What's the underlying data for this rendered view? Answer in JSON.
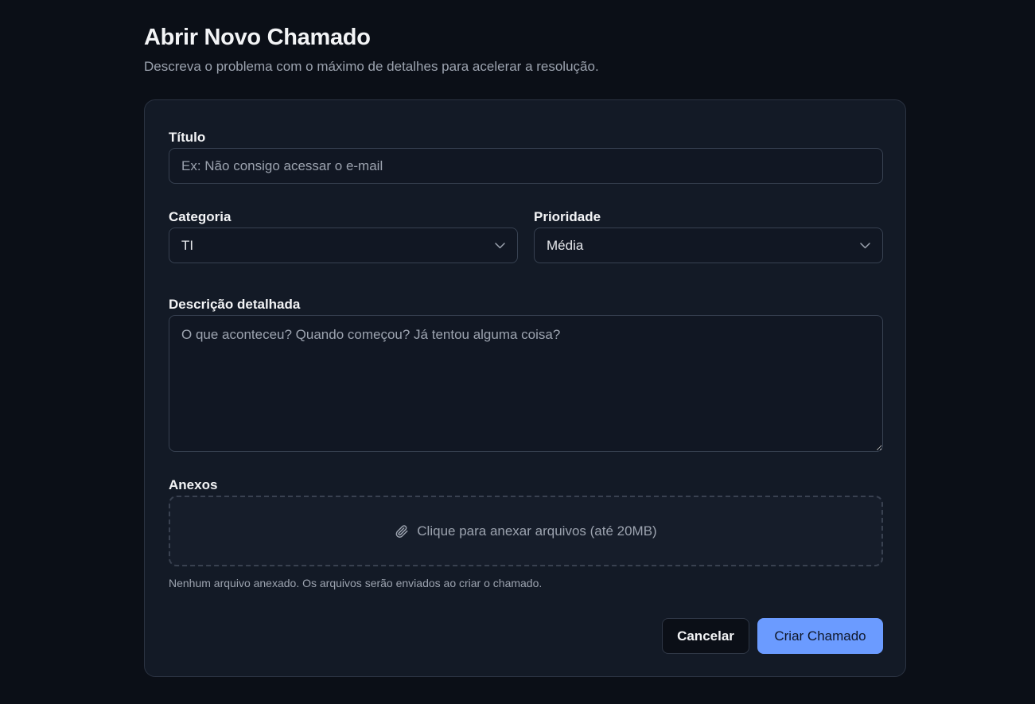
{
  "header": {
    "title": "Abrir Novo Chamado",
    "subtitle": "Descreva o problema com o máximo de detalhes para acelerar a resolução."
  },
  "form": {
    "title_field": {
      "label": "Título",
      "placeholder": "Ex: Não consigo acessar o e-mail",
      "value": ""
    },
    "category": {
      "label": "Categoria",
      "selected": "TI",
      "icon": "chevron-down-icon"
    },
    "priority": {
      "label": "Prioridade",
      "selected": "Média",
      "icon": "chevron-down-icon"
    },
    "description": {
      "label": "Descrição detalhada",
      "placeholder": "O que aconteceu? Quando começou? Já tentou alguma coisa?",
      "value": ""
    },
    "attachments": {
      "label": "Anexos",
      "dropzone_text": "Clique para anexar arquivos (até 20MB)",
      "icon": "paperclip-icon",
      "hint": "Nenhum arquivo anexado. Os arquivos serão enviados ao criar o chamado."
    },
    "actions": {
      "cancel_label": "Cancelar",
      "submit_label": "Criar Chamado"
    }
  },
  "colors": {
    "background": "#0b0f17",
    "card": "#131a26",
    "primary": "#6b9bff"
  }
}
